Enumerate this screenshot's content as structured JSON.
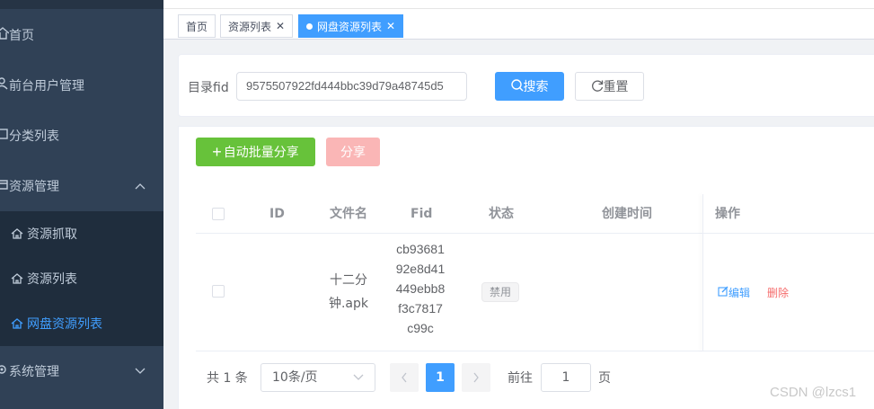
{
  "sidebar": {
    "items": [
      {
        "label": "首页",
        "icon": "home-icon"
      },
      {
        "label": "前台用户管理",
        "icon": "user-icon"
      },
      {
        "label": "分类列表",
        "icon": "category-icon"
      },
      {
        "label": "资源管理",
        "icon": "resource-icon",
        "expanded": true
      },
      {
        "label": "系统管理",
        "icon": "settings-icon",
        "expanded": false
      }
    ],
    "sub_items": [
      {
        "label": "资源抓取",
        "icon": "home-icon"
      },
      {
        "label": "资源列表",
        "icon": "home-icon"
      },
      {
        "label": "网盘资源列表",
        "icon": "home-icon",
        "active": true
      }
    ]
  },
  "tabs": [
    {
      "label": "首页",
      "closable": false
    },
    {
      "label": "资源列表",
      "closable": true
    },
    {
      "label": "网盘资源列表",
      "closable": true,
      "active": true
    }
  ],
  "search": {
    "label": "目录fid",
    "value": "9575507922fd444bbc39d79a48745d5",
    "search_button": "搜索",
    "reset_button": "重置"
  },
  "toolbar": {
    "auto_share_button": "自动批量分享",
    "share_button": "分享"
  },
  "table": {
    "columns": [
      "ID",
      "文件名",
      "Fid",
      "状态",
      "创建时间",
      "操作"
    ],
    "rows": [
      {
        "id": "",
        "filename_lines": [
          "十二分",
          "钟.apk"
        ],
        "fid_lines": [
          "cb93681",
          "92e8d41",
          "449ebb8",
          "f3c7817",
          "c99c"
        ],
        "status": "禁用",
        "created": "",
        "edit_label": "编辑",
        "delete_label": "删除"
      }
    ]
  },
  "pagination": {
    "total_text": "共 1 条",
    "page_size": "10条/页",
    "current_page": "1",
    "goto_label": "前往",
    "goto_value": "1",
    "page_suffix": "页"
  },
  "watermark": "CSDN @lzcs1",
  "colors": {
    "sidebar_bg": "#304156",
    "primary": "#409eff",
    "success": "#67c23a",
    "danger_disabled": "#fab6b6",
    "active_tab": "#409eff"
  }
}
